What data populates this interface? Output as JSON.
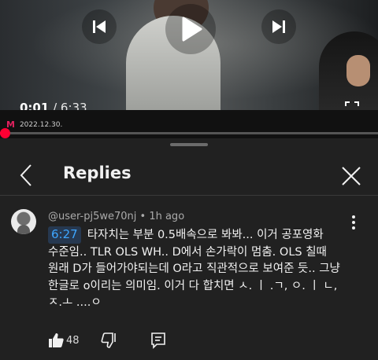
{
  "player": {
    "current_time": "0:01",
    "separator": " / ",
    "duration": "6:33",
    "progress_fraction": 0.003,
    "watermark_logo": "M",
    "watermark_date": "2022.12.30."
  },
  "replies": {
    "title": "Replies"
  },
  "comment": {
    "author": "@user-pj5we70nj",
    "dot": "•",
    "time_ago": "1h ago",
    "timestamp": "6:27",
    "text": "타자치는 부분 0.5배속으로 봐봐... 이거 공포영화 수준임.. TLR OLS WH.. D에서 손가락이 멈춤. OLS 칠때 원래 D가 들어가야되는데 O라고 직관적으로 보여준 듯.. 그냥 한글로 o이리는 의미임. 이거 다 합치면 ㅅ. ㅣ .ㄱ, ㅇ. ㅣ ㄴ, ㅈ.ㅗ ....ㅇ",
    "like_count": "48"
  },
  "colors": {
    "accent_red": "#ff0033",
    "timestamp_blue": "#3ea6ff",
    "sheet_bg": "#212121"
  },
  "icons": [
    "previous-icon",
    "play-icon",
    "next-icon",
    "fullscreen-icon",
    "back-chevron-icon",
    "close-icon",
    "more-vert-icon",
    "thumb-up-icon",
    "thumb-down-icon",
    "reply-icon"
  ]
}
